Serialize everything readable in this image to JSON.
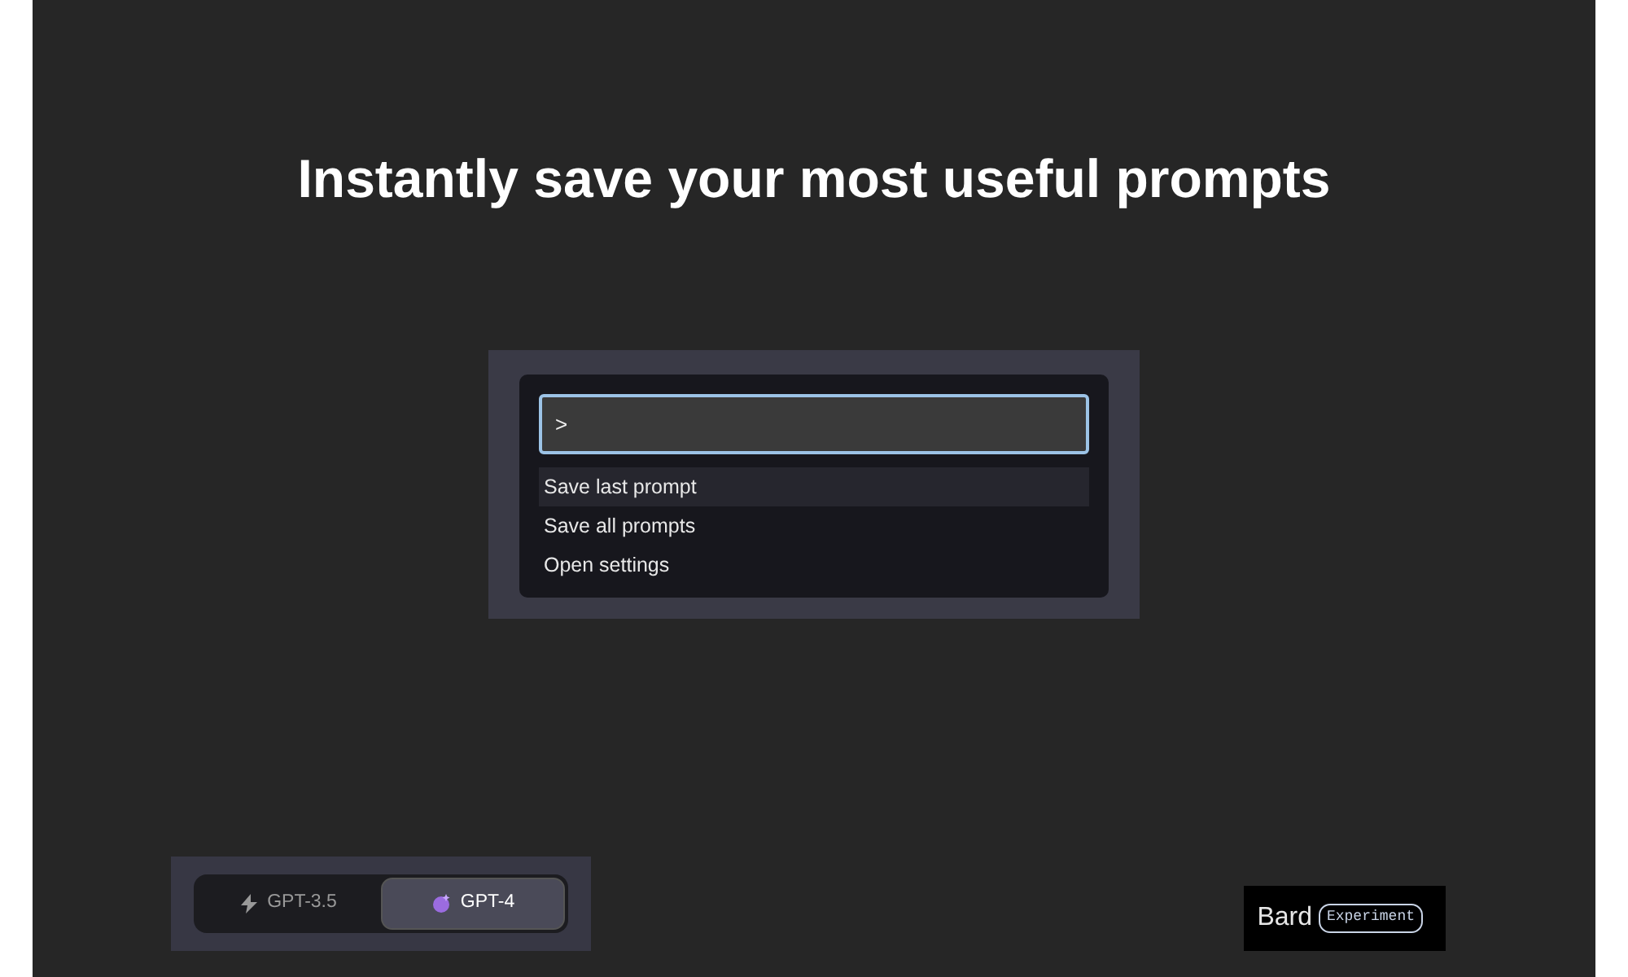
{
  "headline": "Instantly save your most useful prompts",
  "command_palette": {
    "value": ">",
    "items": [
      {
        "label": "Save last prompt",
        "selected": true
      },
      {
        "label": "Save all prompts",
        "selected": false
      },
      {
        "label": "Open settings",
        "selected": false
      }
    ]
  },
  "model_switcher": [
    {
      "label": "GPT-3.5",
      "kind": "bolt",
      "selected": false
    },
    {
      "label": "GPT-4",
      "kind": "sparkle",
      "selected": true
    }
  ],
  "bard_badge": {
    "name": "Bard",
    "tag": "Experiment"
  }
}
